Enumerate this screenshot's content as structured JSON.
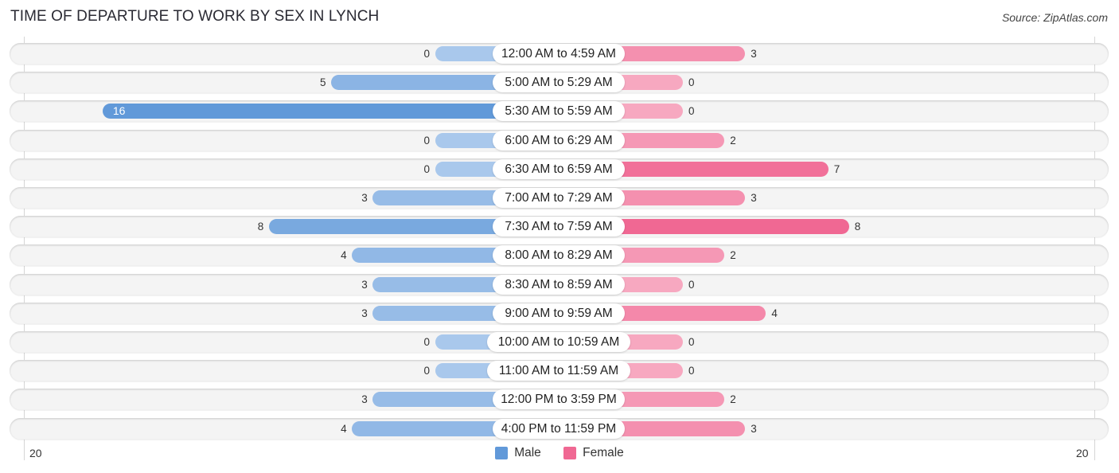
{
  "chart_data": {
    "type": "bar",
    "orientation": "horizontal-diverging",
    "title": "TIME OF DEPARTURE TO WORK BY SEX IN LYNCH",
    "source": "Source: ZipAtlas.com",
    "categories": [
      "12:00 AM to 4:59 AM",
      "5:00 AM to 5:29 AM",
      "5:30 AM to 5:59 AM",
      "6:00 AM to 6:29 AM",
      "6:30 AM to 6:59 AM",
      "7:00 AM to 7:29 AM",
      "7:30 AM to 7:59 AM",
      "8:00 AM to 8:29 AM",
      "8:30 AM to 8:59 AM",
      "9:00 AM to 9:59 AM",
      "10:00 AM to 10:59 AM",
      "11:00 AM to 11:59 AM",
      "12:00 PM to 3:59 PM",
      "4:00 PM to 11:59 PM"
    ],
    "series": [
      {
        "name": "Male",
        "color": "#6199d9",
        "light_color": "#a9c8ec",
        "values": [
          0,
          5,
          16,
          0,
          0,
          3,
          8,
          4,
          3,
          3,
          0,
          0,
          3,
          4
        ]
      },
      {
        "name": "Female",
        "color": "#f06893",
        "light_color": "#f7a8c0",
        "values": [
          3,
          0,
          0,
          2,
          7,
          3,
          8,
          2,
          0,
          4,
          0,
          0,
          2,
          3
        ]
      }
    ],
    "xlim": [
      -20,
      20
    ],
    "axis_tick_labels": {
      "left": "20",
      "right": "20"
    },
    "legend": {
      "position": "bottom-center",
      "items": [
        "Male",
        "Female"
      ]
    },
    "grid": false
  }
}
